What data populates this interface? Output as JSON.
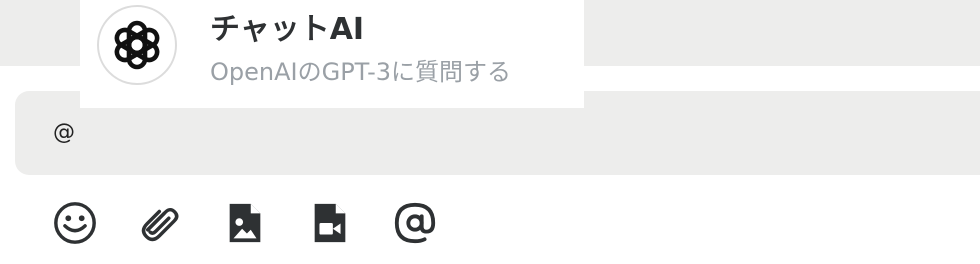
{
  "mention_popup": {
    "bot_name": "チャットAI",
    "bot_description": "OpenAIのGPT-3に質問する",
    "avatar_icon": "openai-logo-icon"
  },
  "composer": {
    "text": "@"
  },
  "toolbar": {
    "buttons": [
      {
        "icon": "emoji-icon"
      },
      {
        "icon": "paperclip-icon"
      },
      {
        "icon": "image-file-icon"
      },
      {
        "icon": "video-file-icon"
      },
      {
        "icon": "mention-icon"
      }
    ]
  },
  "colors": {
    "background_gray": "#ededec",
    "icon": "#2e3133",
    "name_text": "#2e3133",
    "description_text": "#9aa0a6"
  }
}
